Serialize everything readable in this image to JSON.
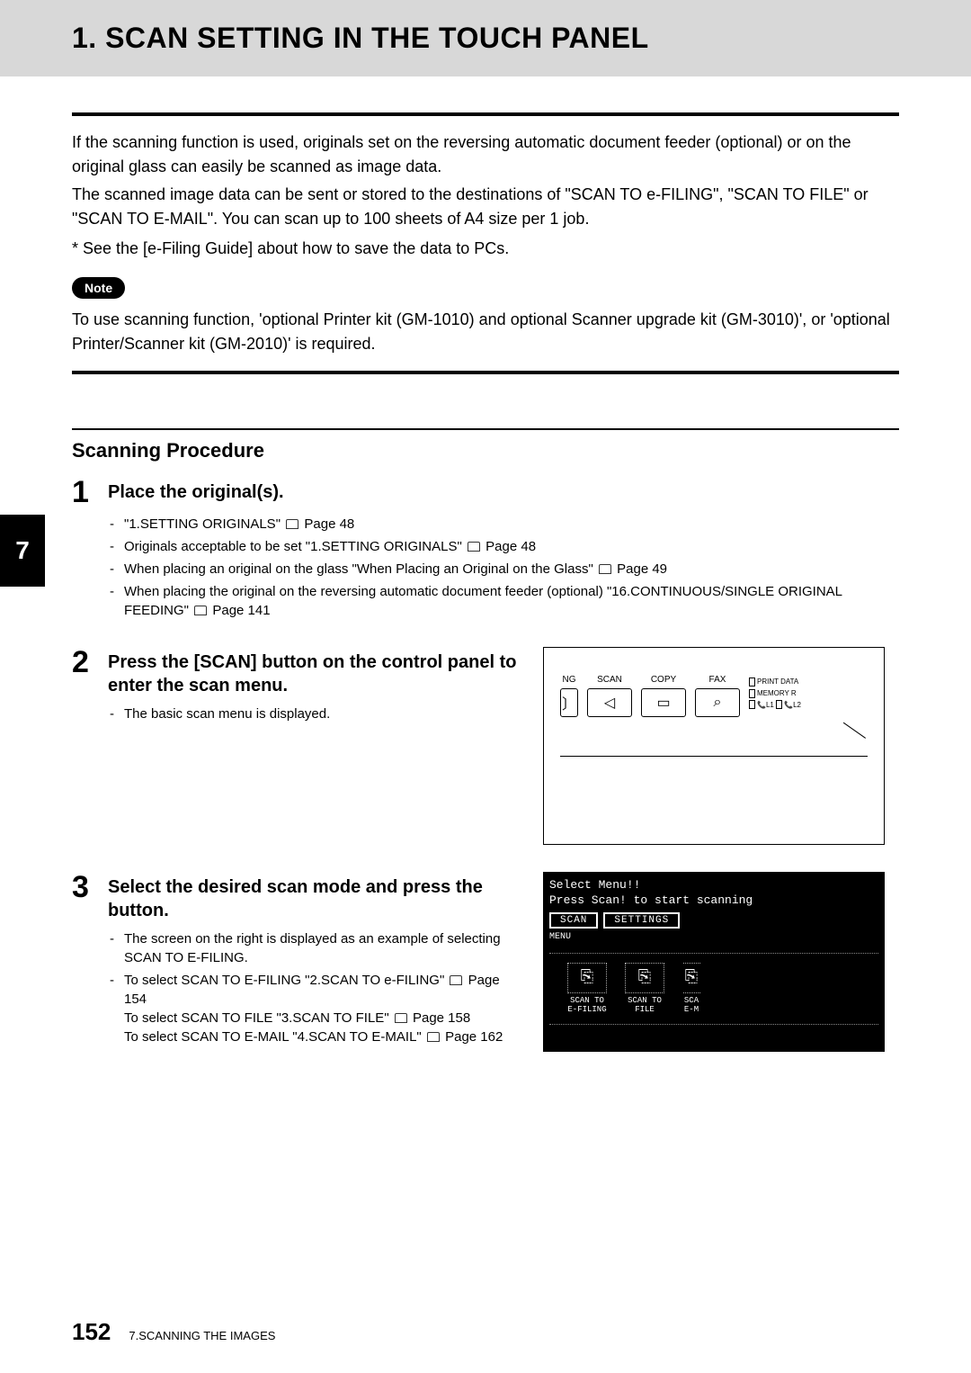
{
  "header": {
    "title": "1. SCAN SETTING IN THE TOUCH PANEL"
  },
  "intro": {
    "p1": "If the scanning function is used, originals set on the reversing automatic document feeder (optional) or on the original glass can easily be scanned as image data.",
    "p2": "The scanned image data can be sent or stored to the destinations of \"SCAN TO e-FILING\", \"SCAN TO FILE\" or \"SCAN TO E-MAIL\". You can scan up to 100 sheets of A4 size per 1 job.",
    "footnote": "*  See the [e-Filing Guide] about how to save the data to PCs."
  },
  "note": {
    "badge": "Note",
    "text": "To use scanning function, 'optional Printer kit (GM-1010) and optional Scanner upgrade kit (GM-3010)', or 'optional Printer/Scanner kit (GM-2010)' is required."
  },
  "section": {
    "heading": "Scanning Procedure"
  },
  "steps": {
    "s1": {
      "num": "1",
      "title": "Place the original(s).",
      "b1a": "\"1.SETTING ORIGINALS\"",
      "b1b": "Page 48",
      "b2a": "Originals acceptable to be set \"1.SETTING ORIGINALS\"",
      "b2b": "Page 48",
      "b3a": "When placing an original on the glass \"When Placing an Original on the Glass\"",
      "b3b": "Page 49",
      "b4a": "When placing the original on the reversing automatic document feeder (optional) \"16.CONTINUOUS/SINGLE ORIGINAL FEEDING\"",
      "b4b": "Page 141"
    },
    "s2": {
      "num": "2",
      "title": "Press the [SCAN] button on the control panel to enter the scan menu.",
      "b1": "The basic scan menu is displayed."
    },
    "s3": {
      "num": "3",
      "title": "Select the desired scan mode and press the button.",
      "b1": "The screen on the right is displayed as an example of selecting SCAN TO E-FILING.",
      "b2a": "To select SCAN TO E-FILING \"2.SCAN TO e-FILING\"",
      "b2b": "Page 154",
      "b2c": "To select SCAN TO FILE \"3.SCAN TO FILE\"",
      "b2d": "Page 158",
      "b2e": "To select SCAN TO E-MAIL \"4.SCAN TO E-MAIL\"",
      "b2f": "Page 162"
    }
  },
  "panel": {
    "ng": "NG",
    "scan": "SCAN",
    "copy": "COPY",
    "fax": "FAX",
    "printdata": "PRINT DATA",
    "memoryrx": "MEMORY R",
    "l1": "L1",
    "l2": "L2"
  },
  "screen": {
    "line1": "Select Menu!!",
    "line2": "Press Scan! to start scanning",
    "tab1": "SCAN",
    "tab2": "SETTINGS",
    "menu": "MENU",
    "opt1": "SCAN TO\nE-FILING",
    "opt2": "SCAN TO\nFILE",
    "opt3": "SCA\nE-M"
  },
  "chapter": {
    "tab": "7"
  },
  "footer": {
    "page": "152",
    "text": "7.SCANNING THE IMAGES"
  }
}
